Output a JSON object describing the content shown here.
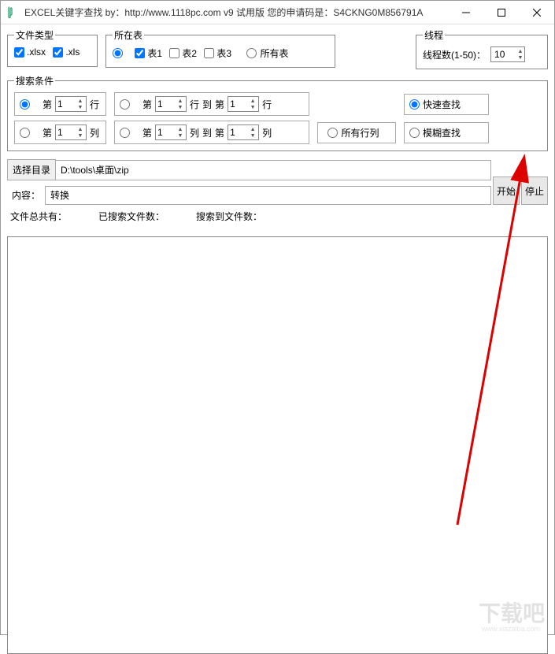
{
  "title": "EXCEL关键字查找  by：http://www.1118pc.com v9 试用版 您的申请码是：S4CKNG0M856791A",
  "fileType": {
    "legend": "文件类型",
    "xlsx": ".xlsx",
    "xls": ".xls"
  },
  "sheet": {
    "legend": "所在表",
    "t1": "表1",
    "t2": "表2",
    "t3": "表3",
    "all": "所有表"
  },
  "thread": {
    "legend": "线程",
    "label": "线程数(1-50)：",
    "value": "10"
  },
  "search": {
    "legend": "搜索条件",
    "di": "第",
    "hang": "行",
    "lie": "列",
    "dao": "到",
    "allCols": "所有行列",
    "fast": "快速查找",
    "fuzzy": "模糊查找",
    "v1": "1",
    "v2": "1",
    "v3": "1",
    "v4": "1",
    "v5": "1",
    "v6": "1"
  },
  "dir": {
    "label": "选择目录",
    "value": "D:\\tools\\桌面\\zip"
  },
  "contentRow": {
    "label": "内容：",
    "value": "转换"
  },
  "actions": {
    "start": "开始",
    "stop": "停止"
  },
  "stats": {
    "total": "文件总共有：",
    "searched": "已搜索文件数：",
    "found": "搜索到文件数："
  },
  "watermark": "下载吧",
  "watermark_sub": "www.xiazaiba.com"
}
